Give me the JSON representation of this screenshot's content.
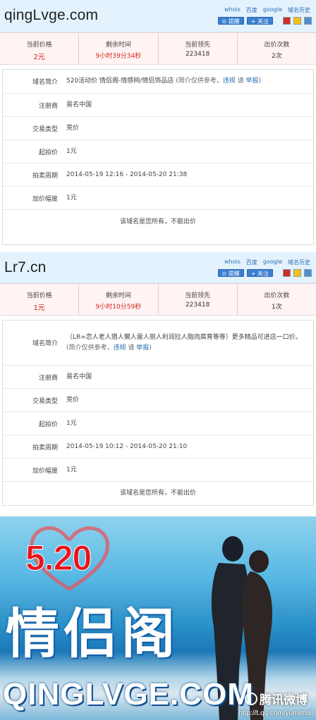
{
  "listings": [
    {
      "domain": "qingLvge.com",
      "links": [
        "whois",
        "百度",
        "google",
        "域名历史"
      ],
      "buttons": [
        "⊙ 提醒",
        "+ 关注"
      ],
      "stats": [
        {
          "label": "当前价格",
          "value": "2元"
        },
        {
          "label": "剩余时间",
          "value": "9小时39分34秒"
        },
        {
          "label": "当前领先",
          "value": "223418"
        },
        {
          "label": "出价次数",
          "value": "2次"
        }
      ],
      "rows": [
        {
          "label": "域名简介",
          "value": "520活动价 情侣阁-情感网/情侣饰品店",
          "note": "(简介仅供参考，",
          "report": "违规",
          "please": "请",
          "report2": "举报",
          "close": ")"
        },
        {
          "label": "注册商",
          "value": "易名中国"
        },
        {
          "label": "交易类型",
          "value": "竞价"
        },
        {
          "label": "起拍价",
          "value": "1元"
        },
        {
          "label": "拍卖周期",
          "value": "2014-05-19 12:16 - 2014-05-20 21:38"
        },
        {
          "label": "加价幅度",
          "value": "1元"
        }
      ],
      "footer": "该域名是您所有，不能出价"
    },
    {
      "domain": "Lr7.cn",
      "links": [
        "whois",
        "百度",
        "google",
        "域名历史"
      ],
      "buttons": [
        "⊙ 提醒",
        "+ 关注"
      ],
      "stats": [
        {
          "label": "当前价格",
          "value": "1元"
        },
        {
          "label": "剩余时间",
          "value": "9小时10分59秒"
        },
        {
          "label": "当前领先",
          "value": "223418"
        },
        {
          "label": "出价次数",
          "value": "1次"
        }
      ],
      "rows": [
        {
          "label": "域名简介",
          "value": "（LR=恋人老人猎人懒人雷人丽人利润拉人脂肉腐育等等）更多精品可进店一口价。",
          "note": "(简介仅供参考，",
          "report": "违规",
          "please": "请",
          "report2": "举报",
          "close": ")"
        },
        {
          "label": "注册商",
          "value": "易名中国"
        },
        {
          "label": "交易类型",
          "value": "竞价"
        },
        {
          "label": "起拍价",
          "value": "1元"
        },
        {
          "label": "拍卖周期",
          "value": "2014-05-19 10:12 - 2014-05-20 21:10"
        },
        {
          "label": "加价幅度",
          "value": "1元"
        }
      ],
      "footer": "该域名是您所有，不能出价"
    }
  ],
  "banner": {
    "number": "5.20",
    "title_cn": "情侣阁",
    "title_en": "QINGLVGE.COM",
    "watermark_brand": "腾讯微博",
    "watermark_url": "http://t.qq.com/yumimall"
  },
  "colors": {
    "header_bg": "#e3f2fd",
    "stats_bg": "#fff3f3",
    "price_red": "#d0281d",
    "link_blue": "#2a6fb5"
  }
}
